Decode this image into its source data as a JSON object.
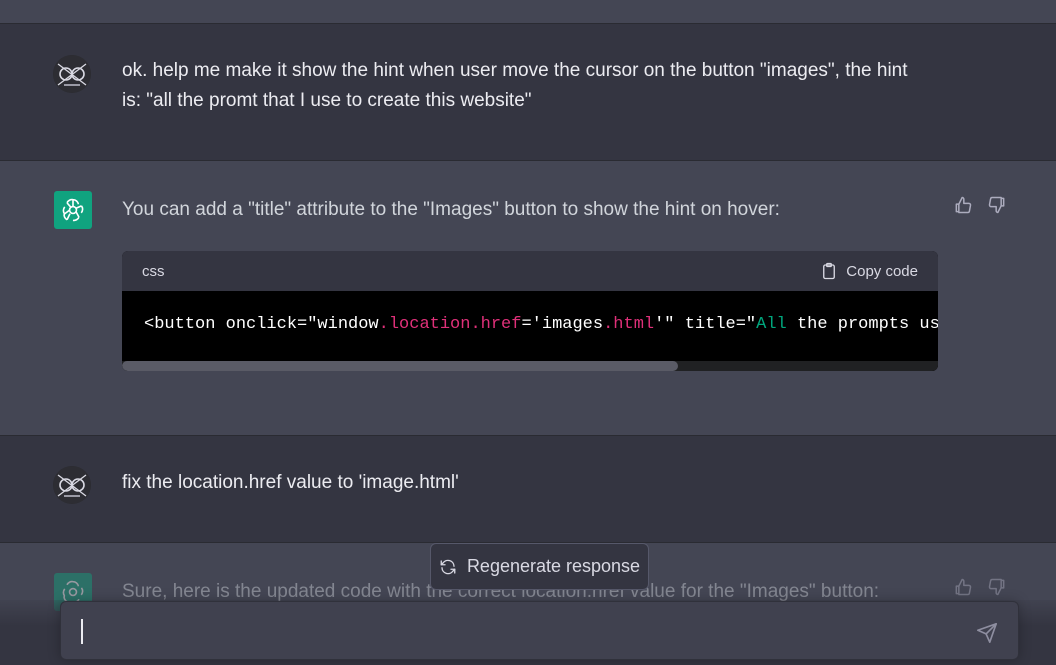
{
  "conversation": {
    "messages": [
      {
        "role": "user",
        "text": "ok. help me make it show the hint when user move the cursor on the button \"images\", the hint is: \"all the promt that I use to create this website\""
      },
      {
        "role": "assistant",
        "text": "You can add a \"title\" attribute to the \"Images\" button to show the hint on hover:",
        "code": {
          "language": "css",
          "copy_label": "Copy code",
          "tokens": [
            {
              "t": "<button onclick=\"window",
              "c": "plain"
            },
            {
              "t": ".location.href",
              "c": "red"
            },
            {
              "t": "='images",
              "c": "plain"
            },
            {
              "t": ".html",
              "c": "red"
            },
            {
              "t": "'\" title=\"",
              "c": "plain"
            },
            {
              "t": "All",
              "c": "green"
            },
            {
              "t": " the prompts used to create this website\">Images</button>",
              "c": "plain"
            }
          ]
        }
      },
      {
        "role": "user",
        "text": "fix the location.href value to 'image.html'"
      },
      {
        "role": "assistant",
        "text": "Sure, here is the updated code with the correct location.href value for the \"Images\" button:"
      }
    ]
  },
  "regenerate_label": "Regenerate response",
  "input": {
    "value": "",
    "placeholder": ""
  },
  "colors": {
    "accent": "#10a37f",
    "user_bg": "#343541",
    "assistant_bg": "#444654",
    "code_red": "#df3079",
    "code_green": "#00a67d"
  },
  "icons": {
    "thumbs_up": "thumbs-up-icon",
    "thumbs_down": "thumbs-down-icon",
    "clipboard": "clipboard-icon",
    "regenerate": "refresh-icon",
    "send": "send-icon",
    "bot": "openai-logo-icon",
    "user": "user-avatar-icon"
  }
}
